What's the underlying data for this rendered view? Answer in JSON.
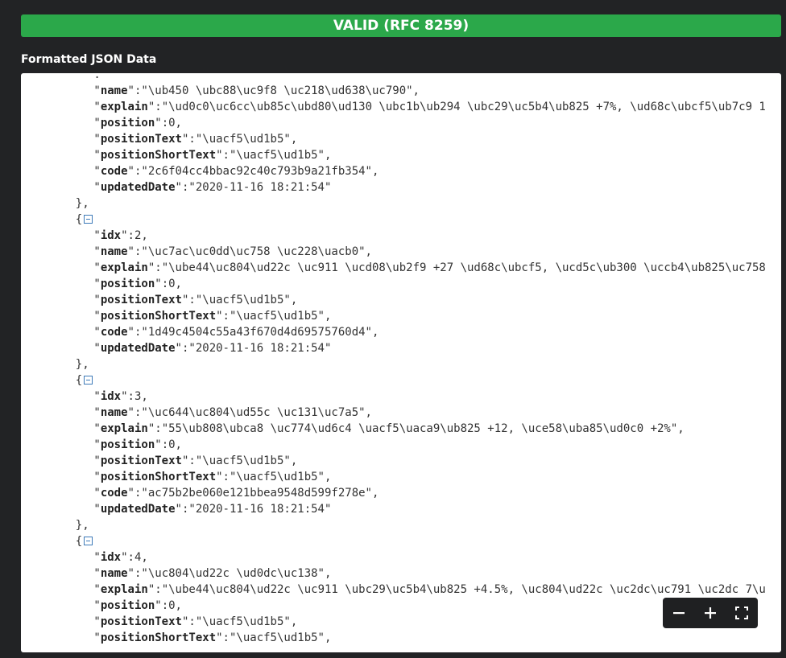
{
  "banner": {
    "text": "VALID (RFC 8259)"
  },
  "section": {
    "title": "Formatted JSON Data"
  },
  "lines": [
    {
      "indent": 8,
      "text": "."
    },
    {
      "indent": 8,
      "key": "name",
      "value": "\"\\ub450 \\ubc88\\uc9f8 \\uc218\\ud638\\uc790\","
    },
    {
      "indent": 8,
      "key": "explain",
      "value": "\"\\ud0c0\\uc6cc\\ub85c\\ubd80\\ud130 \\ubc1b\\ub294 \\ubc29\\uc5b4\\ub825 +7%, \\ud68c\\ubcf5\\ub7c9 1"
    },
    {
      "indent": 8,
      "key": "position",
      "value": "0,"
    },
    {
      "indent": 8,
      "key": "positionText",
      "value": "\"\\uacf5\\ud1b5\","
    },
    {
      "indent": 8,
      "key": "positionShortText",
      "value": "\"\\uacf5\\ud1b5\","
    },
    {
      "indent": 8,
      "key": "code",
      "value": "\"2c6f04cc4bbac92c40c793b9a21fb354\","
    },
    {
      "indent": 8,
      "key": "updatedDate",
      "value": "\"2020-11-16 18:21:54\""
    },
    {
      "indent": 6,
      "text": "},"
    },
    {
      "indent": 6,
      "text": "{",
      "toggle": true
    },
    {
      "indent": 8,
      "key": "idx",
      "value": "2,"
    },
    {
      "indent": 8,
      "key": "name",
      "value": "\"\\uc7ac\\uc0dd\\uc758 \\uc228\\uacb0\","
    },
    {
      "indent": 8,
      "key": "explain",
      "value": "\"\\ube44\\uc804\\ud22c \\uc911 \\ucd08\\ub2f9 +27 \\ud68c\\ubcf5, \\ucd5c\\ub300 \\uccb4\\ub825\\uc758"
    },
    {
      "indent": 8,
      "key": "position",
      "value": "0,"
    },
    {
      "indent": 8,
      "key": "positionText",
      "value": "\"\\uacf5\\ud1b5\","
    },
    {
      "indent": 8,
      "key": "positionShortText",
      "value": "\"\\uacf5\\ud1b5\","
    },
    {
      "indent": 8,
      "key": "code",
      "value": "\"1d49c4504c55a43f670d4d69575760d4\","
    },
    {
      "indent": 8,
      "key": "updatedDate",
      "value": "\"2020-11-16 18:21:54\""
    },
    {
      "indent": 6,
      "text": "},"
    },
    {
      "indent": 6,
      "text": "{",
      "toggle": true
    },
    {
      "indent": 8,
      "key": "idx",
      "value": "3,"
    },
    {
      "indent": 8,
      "key": "name",
      "value": "\"\\uc644\\uc804\\ud55c \\uc131\\uc7a5\","
    },
    {
      "indent": 8,
      "key": "explain",
      "value": "\"55\\ub808\\ubca8 \\uc774\\ud6c4 \\uacf5\\uaca9\\ub825 +12, \\uce58\\uba85\\ud0c0 +2%\","
    },
    {
      "indent": 8,
      "key": "position",
      "value": "0,"
    },
    {
      "indent": 8,
      "key": "positionText",
      "value": "\"\\uacf5\\ud1b5\","
    },
    {
      "indent": 8,
      "key": "positionShortText",
      "value": "\"\\uacf5\\ud1b5\","
    },
    {
      "indent": 8,
      "key": "code",
      "value": "\"ac75b2be060e121bbea9548d599f278e\","
    },
    {
      "indent": 8,
      "key": "updatedDate",
      "value": "\"2020-11-16 18:21:54\""
    },
    {
      "indent": 6,
      "text": "},"
    },
    {
      "indent": 6,
      "text": "{",
      "toggle": true
    },
    {
      "indent": 8,
      "key": "idx",
      "value": "4,"
    },
    {
      "indent": 8,
      "key": "name",
      "value": "\"\\uc804\\ud22c \\ud0dc\\uc138\","
    },
    {
      "indent": 8,
      "key": "explain",
      "value": "\"\\ube44\\uc804\\ud22c \\uc911 \\ubc29\\uc5b4\\ub825 +4.5%, \\uc804\\ud22c \\uc2dc\\uc791 \\uc2dc 7\\u"
    },
    {
      "indent": 8,
      "key": "position",
      "value": "0,"
    },
    {
      "indent": 8,
      "key": "positionText",
      "value": "\"\\uacf5\\ud1b5\","
    },
    {
      "indent": 8,
      "key": "positionShortText",
      "value": "\"\\uacf5\\ud1b5\","
    }
  ],
  "zoom": {
    "zoom_out_icon": "minus-icon",
    "zoom_in_icon": "plus-icon",
    "fullscreen_icon": "fullscreen-icon"
  }
}
